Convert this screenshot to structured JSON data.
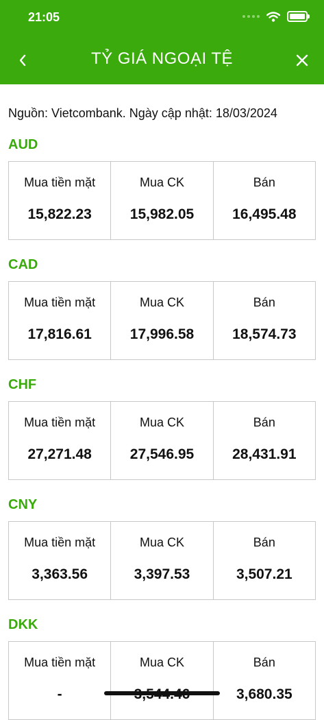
{
  "status_bar": {
    "time": "21:05"
  },
  "header": {
    "title": "TỶ GIÁ NGOẠI TỆ"
  },
  "source_note": "Nguồn: Vietcombank. Ngày cập nhật: 18/03/2024",
  "column_labels": {
    "cash_buy": "Mua tiền mặt",
    "transfer_buy": "Mua CK",
    "sell": "Bán"
  },
  "currencies": [
    {
      "code": "AUD",
      "cash_buy": "15,822.23",
      "transfer_buy": "15,982.05",
      "sell": "16,495.48"
    },
    {
      "code": "CAD",
      "cash_buy": "17,816.61",
      "transfer_buy": "17,996.58",
      "sell": "18,574.73"
    },
    {
      "code": "CHF",
      "cash_buy": "27,271.48",
      "transfer_buy": "27,546.95",
      "sell": "28,431.91"
    },
    {
      "code": "CNY",
      "cash_buy": "3,363.56",
      "transfer_buy": "3,397.53",
      "sell": "3,507.21"
    },
    {
      "code": "DKK",
      "cash_buy": "-",
      "transfer_buy": "3,544.46",
      "sell": "3,680.35"
    }
  ],
  "colors": {
    "brand_green": "#3aaa0c",
    "border": "#c8c8c8"
  }
}
